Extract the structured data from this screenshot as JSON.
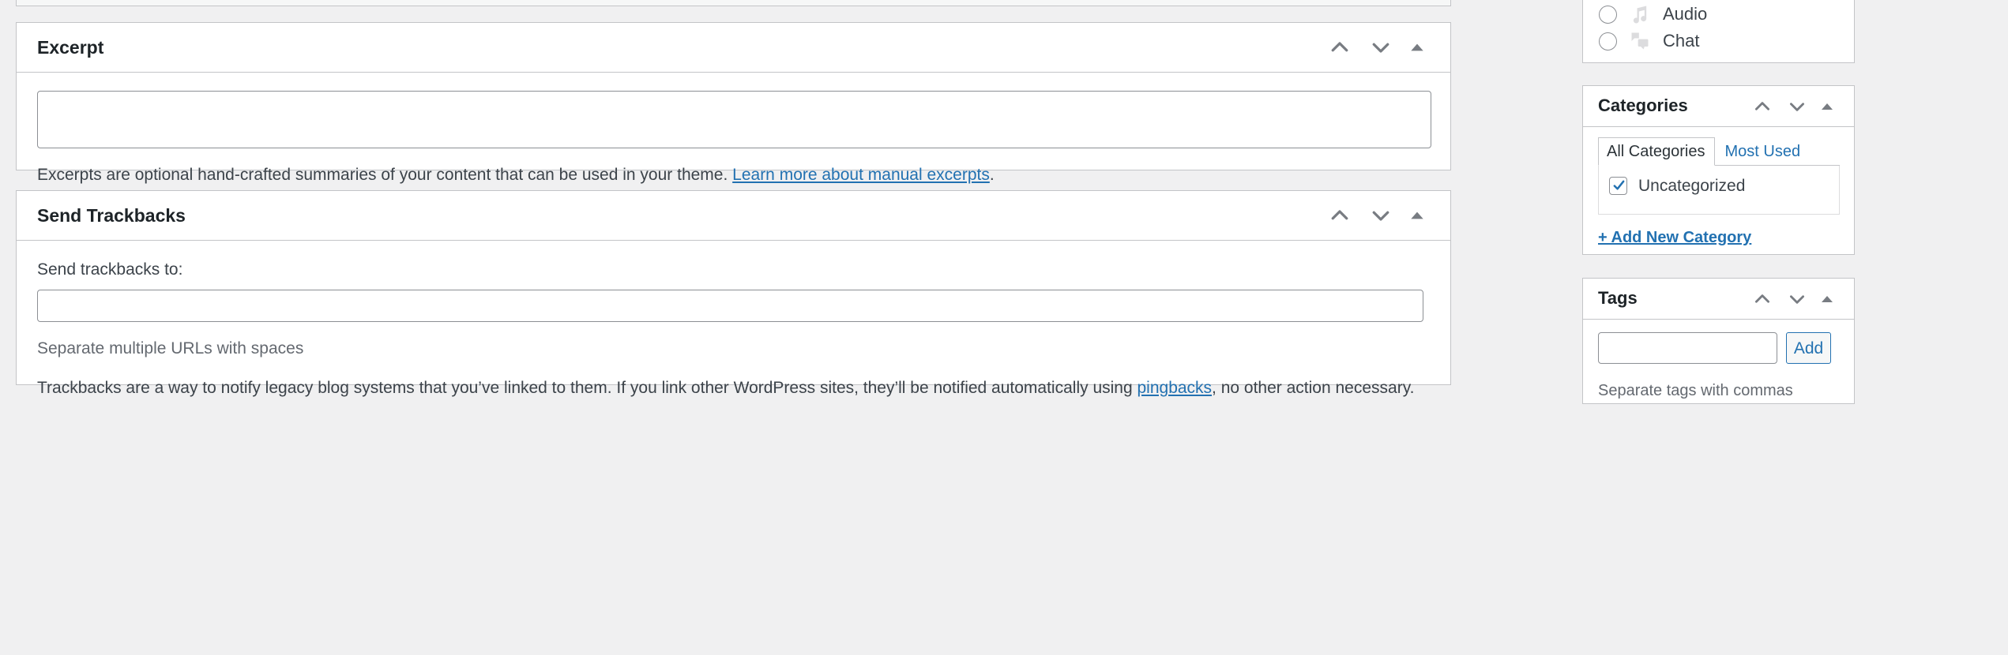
{
  "colors": {
    "accent": "#2271b1",
    "panel_border": "#c3c4c7",
    "page_bg": "#f0f0f1",
    "heading": "#1d2327",
    "body_text": "#3c434a",
    "muted_text": "#646970",
    "icon_gray": "#787c82",
    "format_icon": "#dcdcde"
  },
  "panel_controls": {
    "move_up_label": "Move up",
    "move_down_label": "Move down",
    "toggle_label": "Toggle panel"
  },
  "excerpt": {
    "title": "Excerpt",
    "textarea_value": "",
    "textarea_placeholder": "",
    "help_prefix": "Excerpts are optional hand-crafted summaries of your content that can be used in your theme. ",
    "help_link": "Learn more about manual excerpts",
    "help_suffix": "."
  },
  "trackbacks": {
    "title": "Send Trackbacks",
    "field_label": "Send trackbacks to:",
    "input_value": "",
    "input_placeholder": "",
    "hint": "Separate multiple URLs with spaces",
    "desc_prefix": "Trackbacks are a way to notify legacy blog systems that you’ve linked to them. If you link other WordPress sites, they’ll be notified automatically using ",
    "desc_link": "pingbacks",
    "desc_suffix": ", no other action necessary."
  },
  "post_format": {
    "options": [
      {
        "label": "Audio",
        "icon": "audio-format-icon",
        "selected": false
      },
      {
        "label": "Chat",
        "icon": "chat-format-icon",
        "selected": false
      }
    ]
  },
  "categories": {
    "title": "Categories",
    "tabs": [
      {
        "label": "All Categories",
        "active": true
      },
      {
        "label": "Most Used",
        "active": false
      }
    ],
    "items": [
      {
        "label": "Uncategorized",
        "checked": true
      }
    ],
    "add_new_link": "+ Add New Category"
  },
  "tags": {
    "title": "Tags",
    "input_value": "",
    "input_placeholder": "",
    "add_button": "Add",
    "hint": "Separate tags with commas"
  }
}
